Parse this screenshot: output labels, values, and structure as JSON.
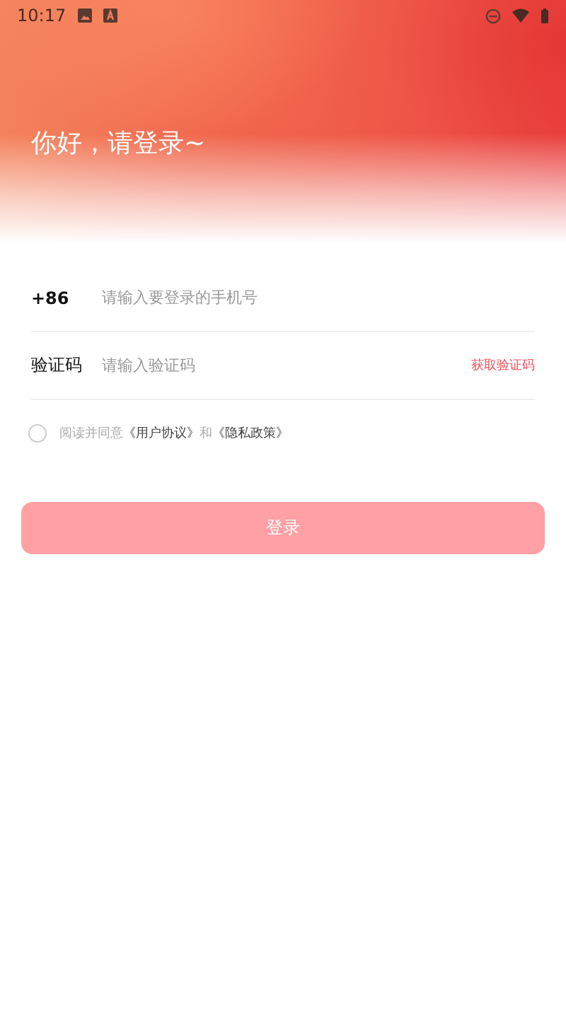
{
  "status_bar": {
    "time": "10:17"
  },
  "header": {
    "greeting": "你好，请登录~"
  },
  "phone": {
    "prefix": "+86",
    "placeholder": "请输入要登录的手机号"
  },
  "code": {
    "label": "验证码",
    "placeholder": "请输入验证码",
    "action": "获取验证码"
  },
  "agreement": {
    "checked": false,
    "parts": [
      {
        "kind": "text",
        "text": "阅读并同意"
      },
      {
        "kind": "link",
        "text": "《用户协议》"
      },
      {
        "kind": "text",
        "text": "和"
      },
      {
        "kind": "link",
        "text": "《隐私政策》"
      }
    ]
  },
  "login_button": {
    "label": "登录",
    "disabled": true
  }
}
